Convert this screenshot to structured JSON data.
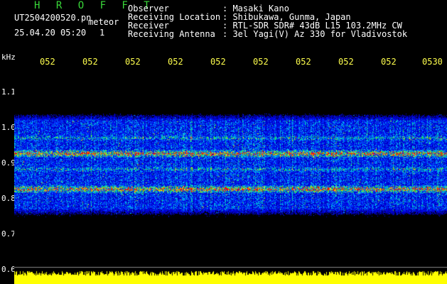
{
  "title": "H R O F F T",
  "file": {
    "name": "UT2504200520.pn",
    "label": "meteor"
  },
  "stamp": {
    "datetime": "25.04.20 05:20",
    "count": "1"
  },
  "info": [
    {
      "label": "Observer",
      "value": ": Masaki Kano"
    },
    {
      "label": "Receiving Location",
      "value": ": Shibukawa, Gunma, Japan"
    },
    {
      "label": "Receiver",
      "value": ": RTL-SDR SDR# 43dB L15 103.2MHz CW"
    },
    {
      "label": "Receiving Antenna",
      "value": ": 3el Yagi(V) Az 330 for Vladivostok"
    }
  ],
  "axis": {
    "y_unit": "kHz",
    "y_ticks": [
      "1.1",
      "1.0",
      "0.9",
      "0.8",
      "0.7",
      "0.6"
    ],
    "x_ticks": [
      "052",
      "052",
      "052",
      "052",
      "052",
      "052",
      "052",
      "052",
      "052",
      "0530"
    ]
  },
  "colors": {
    "background": "#000000",
    "title": "#39d739",
    "labels": "#ffffff",
    "time_ticks": "#ffff4d",
    "power_trace": "#ffff00"
  }
}
